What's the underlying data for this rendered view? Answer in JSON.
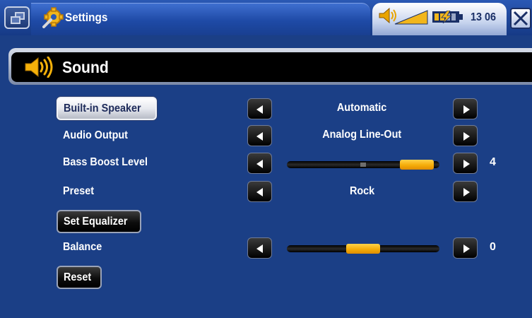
{
  "topbar": {
    "app_title": "Settings",
    "clock": "13 06",
    "icons": {
      "menu": "window-switch-icon",
      "app": "gear-icon",
      "volume": "volume-level-icon",
      "battery": "battery-charging-icon",
      "close": "close-icon"
    }
  },
  "section": {
    "title": "Sound",
    "icon": "speaker-icon"
  },
  "rows": [
    {
      "label": "Built-in Speaker",
      "type": "button",
      "selected": true,
      "value": "Automatic"
    },
    {
      "label": "Audio Output",
      "type": "option",
      "value": "Analog Line-Out"
    },
    {
      "label": "Bass Boost Level",
      "type": "slider",
      "value": "4",
      "level_fraction": 0.95
    },
    {
      "label": "Preset",
      "type": "option",
      "value": "Rock"
    },
    {
      "label": "Set Equalizer",
      "type": "button"
    },
    {
      "label": "Balance",
      "type": "slider",
      "value": "0",
      "level_fraction": 0.5
    },
    {
      "label": "Reset",
      "type": "button"
    }
  ],
  "colors": {
    "background": "#1b3f86",
    "accent_slider": "#f5ad0a",
    "section_bar": "#000000"
  }
}
